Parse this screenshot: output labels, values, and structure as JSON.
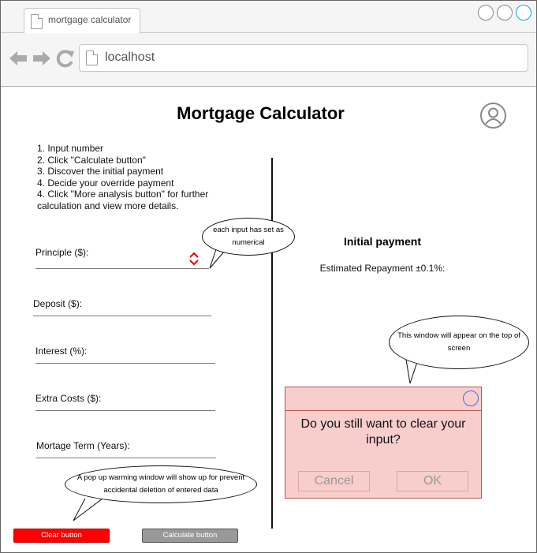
{
  "browser": {
    "tab_title": "mortgage calculator",
    "url": "localhost"
  },
  "page": {
    "title": "Mortgage Calculator",
    "instructions": [
      "1. Input number",
      "2. Click \"Calculate button\"",
      "3. Discover the initial payment",
      "4. Decide your override payment",
      "4. Click \"More analysis button\" for further calculation and view more details."
    ]
  },
  "fields": {
    "principle": "Principle ($):",
    "deposit": "Deposit ($):",
    "interest": "Interest (%):",
    "extra_costs": "Extra Costs ($):",
    "term": "Mortage Term (Years):"
  },
  "results": {
    "heading": "Initial payment",
    "estimated_label": "Estimated Repayment ±0.1%:"
  },
  "notes": {
    "numeric": "each input has set as numerical",
    "window_top": "This window will appear on the top of screen",
    "popup_warning": "A pop up warming window will show up for prevent accidental deletion of entered data"
  },
  "dialog": {
    "message": "Do you still want to clear your input?",
    "cancel_label": "Cancel",
    "ok_label": "OK"
  },
  "buttons": {
    "clear_label": "Clear button",
    "calculate_label": "Calculate button"
  },
  "colors": {
    "clear_button": "#ff0000",
    "calculate_button": "#999999",
    "dialog_background": "#f8cecc"
  }
}
